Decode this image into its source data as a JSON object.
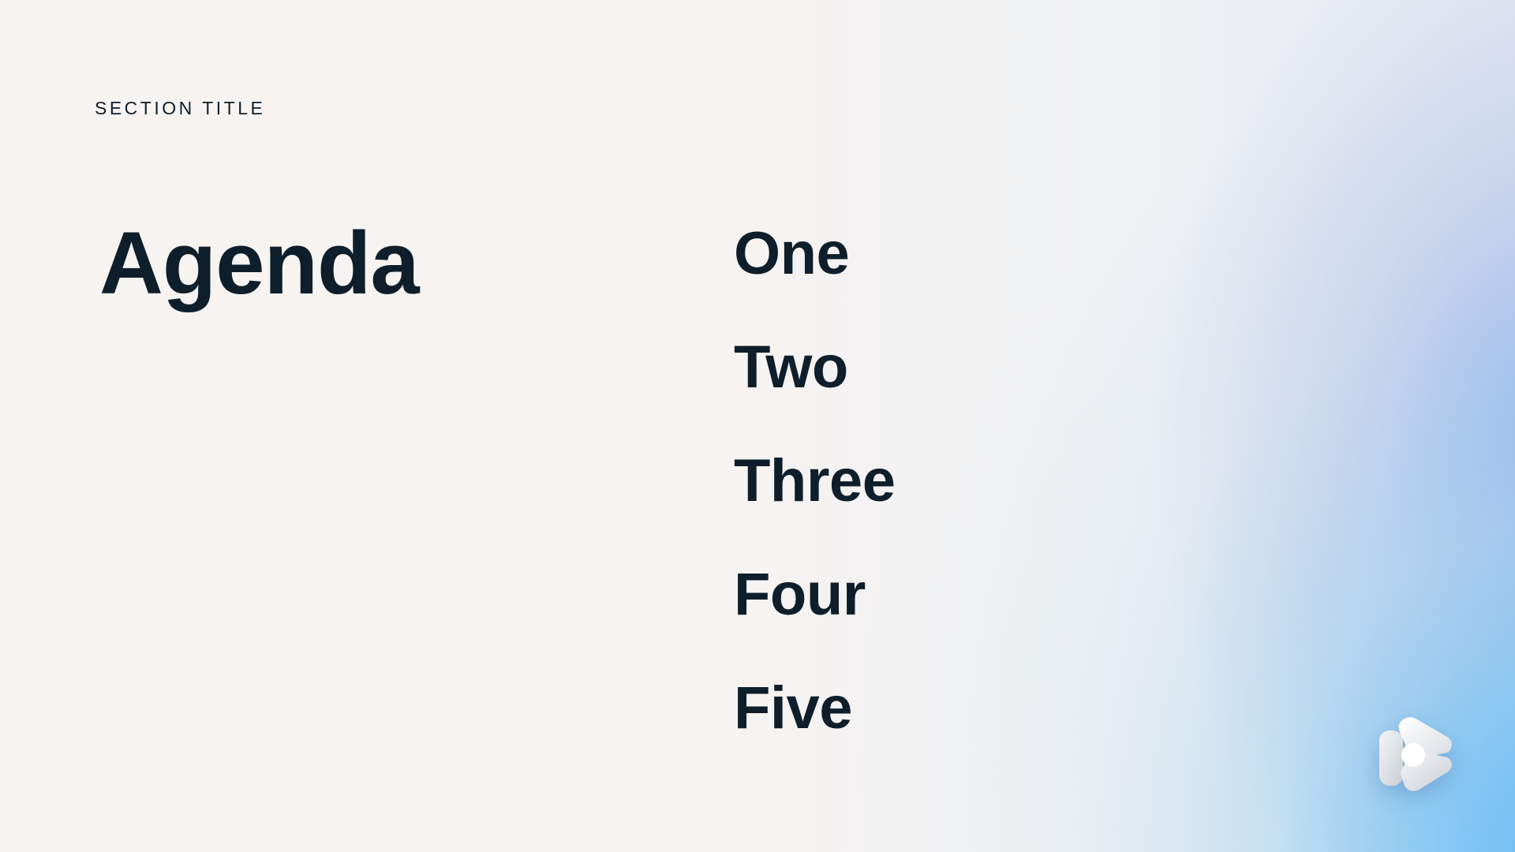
{
  "slide": {
    "section_title": "SECTION TITLE",
    "heading": "Agenda",
    "items": [
      "One",
      "Two",
      "Three",
      "Four",
      "Five"
    ]
  },
  "logo": {
    "icon": "play-logo-icon"
  },
  "colors": {
    "text": "#0e1f2b",
    "background": "#f6f3f1",
    "accent_blue": "#60baf4",
    "accent_periwinkle": "#8cafeb"
  }
}
